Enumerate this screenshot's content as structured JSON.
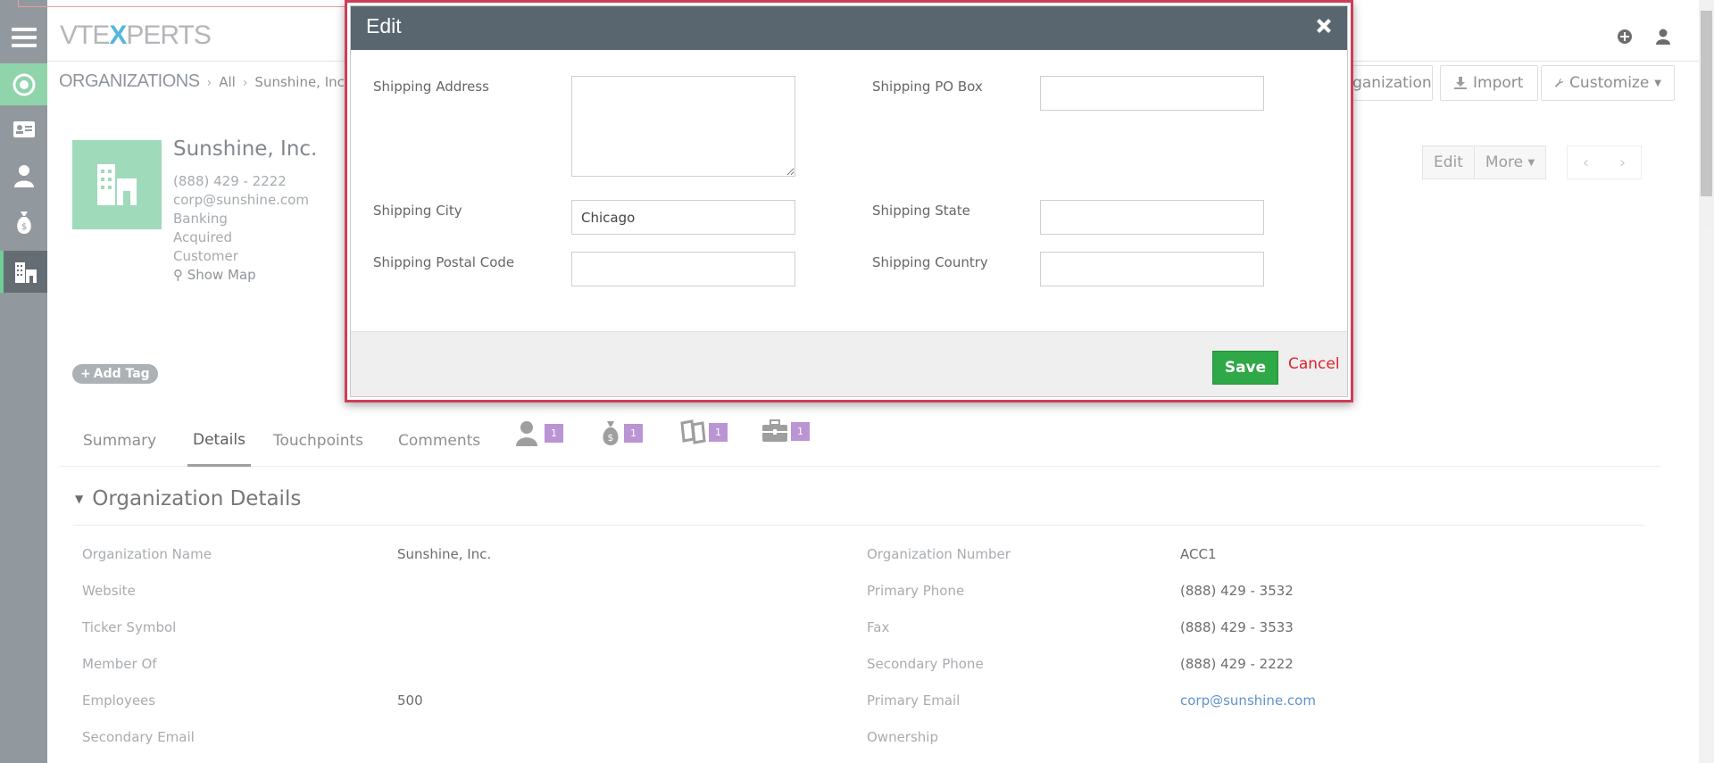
{
  "app": {
    "logo_prefix": "VTE",
    "logo_x": "X",
    "logo_suffix": "PERTS"
  },
  "breadcrumb": {
    "module": "ORGANIZATIONS",
    "filter": "All",
    "record": "Sunshine, Inc."
  },
  "header_actions": {
    "add_org_label": "Organization",
    "import_label": "Import",
    "customize_label": "Customize"
  },
  "record": {
    "title": "Sunshine, Inc.",
    "phone": "(888) 429 - 2222",
    "email": "corp@sunshine.com",
    "industry": "Banking",
    "rating": "Acquired",
    "type": "Customer",
    "show_map": "Show Map",
    "add_tag": "Add Tag",
    "edit_label": "Edit",
    "more_label": "More"
  },
  "tabs": [
    {
      "label": "Summary"
    },
    {
      "label": "Details"
    },
    {
      "label": "Touchpoints"
    },
    {
      "label": "Comments"
    }
  ],
  "related_badges": [
    {
      "icon": "contacts-icon",
      "count": "1"
    },
    {
      "icon": "deals-icon",
      "count": "1"
    },
    {
      "icon": "quotes-icon",
      "count": "1"
    },
    {
      "icon": "projects-icon",
      "count": "1"
    }
  ],
  "details": {
    "section_title": "Organization Details",
    "left": [
      {
        "label": "Organization Name",
        "value": "Sunshine, Inc."
      },
      {
        "label": "Website",
        "value": ""
      },
      {
        "label": "Ticker Symbol",
        "value": ""
      },
      {
        "label": "Member Of",
        "value": ""
      },
      {
        "label": "Employees",
        "value": "500"
      },
      {
        "label": "Secondary Email",
        "value": ""
      }
    ],
    "right": [
      {
        "label": "Organization Number",
        "value": "ACC1"
      },
      {
        "label": "Primary Phone",
        "value": "(888) 429 - 3532"
      },
      {
        "label": "Fax",
        "value": "(888) 429 - 3533"
      },
      {
        "label": "Secondary Phone",
        "value": "(888) 429 - 2222"
      },
      {
        "label": "Primary Email",
        "value": "corp@sunshine.com"
      },
      {
        "label": "Ownership",
        "value": ""
      }
    ]
  },
  "modal": {
    "title": "Edit",
    "fields": {
      "shipping_address_label": "Shipping Address",
      "shipping_address_value": "",
      "shipping_po_box_label": "Shipping PO Box",
      "shipping_po_box_value": "",
      "shipping_city_label": "Shipping City",
      "shipping_city_value": "Chicago",
      "shipping_state_label": "Shipping State",
      "shipping_state_value": "",
      "shipping_postal_code_label": "Shipping Postal Code",
      "shipping_postal_code_value": "",
      "shipping_country_label": "Shipping Country",
      "shipping_country_value": ""
    },
    "save_label": "Save",
    "cancel_label": "Cancel"
  },
  "colors": {
    "accent_green": "#8ad2a7",
    "modal_border": "#d03c58",
    "modal_header": "#5a666f",
    "save_button": "#2fa847",
    "cancel_text": "#e0222a",
    "badge": "#b88fd2"
  }
}
